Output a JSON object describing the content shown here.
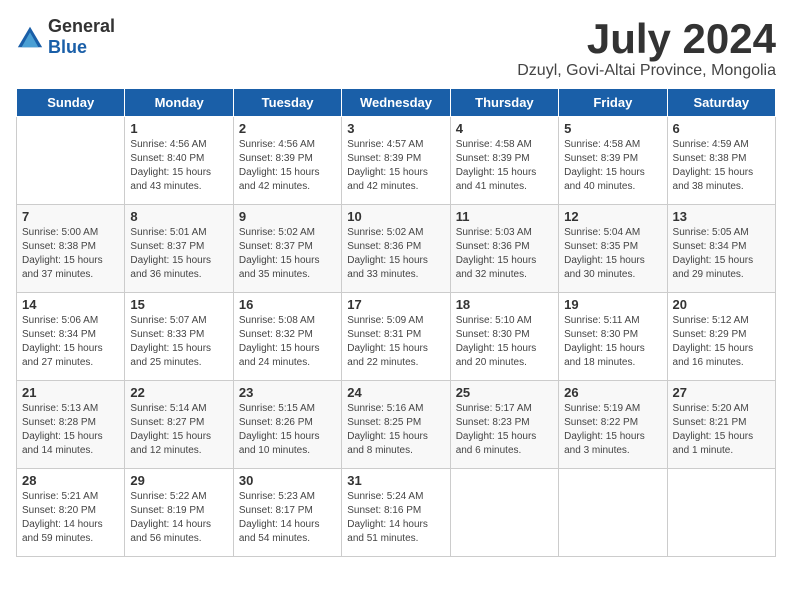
{
  "logo": {
    "general": "General",
    "blue": "Blue"
  },
  "title": {
    "month_year": "July 2024",
    "location": "Dzuyl, Govi-Altai Province, Mongolia"
  },
  "headers": [
    "Sunday",
    "Monday",
    "Tuesday",
    "Wednesday",
    "Thursday",
    "Friday",
    "Saturday"
  ],
  "weeks": [
    [
      {
        "day": "",
        "sunrise": "",
        "sunset": "",
        "daylight": ""
      },
      {
        "day": "1",
        "sunrise": "Sunrise: 4:56 AM",
        "sunset": "Sunset: 8:40 PM",
        "daylight": "Daylight: 15 hours and 43 minutes."
      },
      {
        "day": "2",
        "sunrise": "Sunrise: 4:56 AM",
        "sunset": "Sunset: 8:39 PM",
        "daylight": "Daylight: 15 hours and 42 minutes."
      },
      {
        "day": "3",
        "sunrise": "Sunrise: 4:57 AM",
        "sunset": "Sunset: 8:39 PM",
        "daylight": "Daylight: 15 hours and 42 minutes."
      },
      {
        "day": "4",
        "sunrise": "Sunrise: 4:58 AM",
        "sunset": "Sunset: 8:39 PM",
        "daylight": "Daylight: 15 hours and 41 minutes."
      },
      {
        "day": "5",
        "sunrise": "Sunrise: 4:58 AM",
        "sunset": "Sunset: 8:39 PM",
        "daylight": "Daylight: 15 hours and 40 minutes."
      },
      {
        "day": "6",
        "sunrise": "Sunrise: 4:59 AM",
        "sunset": "Sunset: 8:38 PM",
        "daylight": "Daylight: 15 hours and 38 minutes."
      }
    ],
    [
      {
        "day": "7",
        "sunrise": "Sunrise: 5:00 AM",
        "sunset": "Sunset: 8:38 PM",
        "daylight": "Daylight: 15 hours and 37 minutes."
      },
      {
        "day": "8",
        "sunrise": "Sunrise: 5:01 AM",
        "sunset": "Sunset: 8:37 PM",
        "daylight": "Daylight: 15 hours and 36 minutes."
      },
      {
        "day": "9",
        "sunrise": "Sunrise: 5:02 AM",
        "sunset": "Sunset: 8:37 PM",
        "daylight": "Daylight: 15 hours and 35 minutes."
      },
      {
        "day": "10",
        "sunrise": "Sunrise: 5:02 AM",
        "sunset": "Sunset: 8:36 PM",
        "daylight": "Daylight: 15 hours and 33 minutes."
      },
      {
        "day": "11",
        "sunrise": "Sunrise: 5:03 AM",
        "sunset": "Sunset: 8:36 PM",
        "daylight": "Daylight: 15 hours and 32 minutes."
      },
      {
        "day": "12",
        "sunrise": "Sunrise: 5:04 AM",
        "sunset": "Sunset: 8:35 PM",
        "daylight": "Daylight: 15 hours and 30 minutes."
      },
      {
        "day": "13",
        "sunrise": "Sunrise: 5:05 AM",
        "sunset": "Sunset: 8:34 PM",
        "daylight": "Daylight: 15 hours and 29 minutes."
      }
    ],
    [
      {
        "day": "14",
        "sunrise": "Sunrise: 5:06 AM",
        "sunset": "Sunset: 8:34 PM",
        "daylight": "Daylight: 15 hours and 27 minutes."
      },
      {
        "day": "15",
        "sunrise": "Sunrise: 5:07 AM",
        "sunset": "Sunset: 8:33 PM",
        "daylight": "Daylight: 15 hours and 25 minutes."
      },
      {
        "day": "16",
        "sunrise": "Sunrise: 5:08 AM",
        "sunset": "Sunset: 8:32 PM",
        "daylight": "Daylight: 15 hours and 24 minutes."
      },
      {
        "day": "17",
        "sunrise": "Sunrise: 5:09 AM",
        "sunset": "Sunset: 8:31 PM",
        "daylight": "Daylight: 15 hours and 22 minutes."
      },
      {
        "day": "18",
        "sunrise": "Sunrise: 5:10 AM",
        "sunset": "Sunset: 8:30 PM",
        "daylight": "Daylight: 15 hours and 20 minutes."
      },
      {
        "day": "19",
        "sunrise": "Sunrise: 5:11 AM",
        "sunset": "Sunset: 8:30 PM",
        "daylight": "Daylight: 15 hours and 18 minutes."
      },
      {
        "day": "20",
        "sunrise": "Sunrise: 5:12 AM",
        "sunset": "Sunset: 8:29 PM",
        "daylight": "Daylight: 15 hours and 16 minutes."
      }
    ],
    [
      {
        "day": "21",
        "sunrise": "Sunrise: 5:13 AM",
        "sunset": "Sunset: 8:28 PM",
        "daylight": "Daylight: 15 hours and 14 minutes."
      },
      {
        "day": "22",
        "sunrise": "Sunrise: 5:14 AM",
        "sunset": "Sunset: 8:27 PM",
        "daylight": "Daylight: 15 hours and 12 minutes."
      },
      {
        "day": "23",
        "sunrise": "Sunrise: 5:15 AM",
        "sunset": "Sunset: 8:26 PM",
        "daylight": "Daylight: 15 hours and 10 minutes."
      },
      {
        "day": "24",
        "sunrise": "Sunrise: 5:16 AM",
        "sunset": "Sunset: 8:25 PM",
        "daylight": "Daylight: 15 hours and 8 minutes."
      },
      {
        "day": "25",
        "sunrise": "Sunrise: 5:17 AM",
        "sunset": "Sunset: 8:23 PM",
        "daylight": "Daylight: 15 hours and 6 minutes."
      },
      {
        "day": "26",
        "sunrise": "Sunrise: 5:19 AM",
        "sunset": "Sunset: 8:22 PM",
        "daylight": "Daylight: 15 hours and 3 minutes."
      },
      {
        "day": "27",
        "sunrise": "Sunrise: 5:20 AM",
        "sunset": "Sunset: 8:21 PM",
        "daylight": "Daylight: 15 hours and 1 minute."
      }
    ],
    [
      {
        "day": "28",
        "sunrise": "Sunrise: 5:21 AM",
        "sunset": "Sunset: 8:20 PM",
        "daylight": "Daylight: 14 hours and 59 minutes."
      },
      {
        "day": "29",
        "sunrise": "Sunrise: 5:22 AM",
        "sunset": "Sunset: 8:19 PM",
        "daylight": "Daylight: 14 hours and 56 minutes."
      },
      {
        "day": "30",
        "sunrise": "Sunrise: 5:23 AM",
        "sunset": "Sunset: 8:17 PM",
        "daylight": "Daylight: 14 hours and 54 minutes."
      },
      {
        "day": "31",
        "sunrise": "Sunrise: 5:24 AM",
        "sunset": "Sunset: 8:16 PM",
        "daylight": "Daylight: 14 hours and 51 minutes."
      },
      {
        "day": "",
        "sunrise": "",
        "sunset": "",
        "daylight": ""
      },
      {
        "day": "",
        "sunrise": "",
        "sunset": "",
        "daylight": ""
      },
      {
        "day": "",
        "sunrise": "",
        "sunset": "",
        "daylight": ""
      }
    ]
  ]
}
